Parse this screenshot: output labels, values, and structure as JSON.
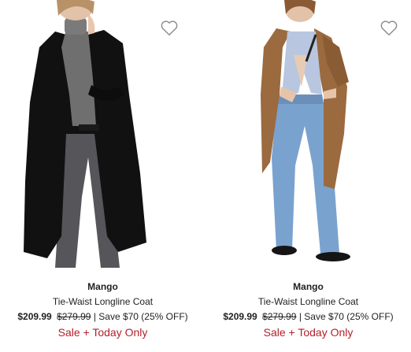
{
  "products": [
    {
      "brand": "Mango",
      "name": "Tie-Waist Longline Coat",
      "price": "$209.99",
      "original_price": "$279.99",
      "savings": "| Save $70 (25% OFF)",
      "promo": "Sale + Today Only",
      "coat_color": "#111111"
    },
    {
      "brand": "Mango",
      "name": "Tie-Waist Longline Coat",
      "price": "$209.99",
      "original_price": "$279.99",
      "savings": "| Save $70 (25% OFF)",
      "promo": "Sale + Today Only",
      "coat_color": "#9b6a3e"
    }
  ],
  "icons": {
    "favorite": "heart-outline-icon"
  },
  "colors": {
    "promo": "#b4202a",
    "text": "#222222"
  }
}
